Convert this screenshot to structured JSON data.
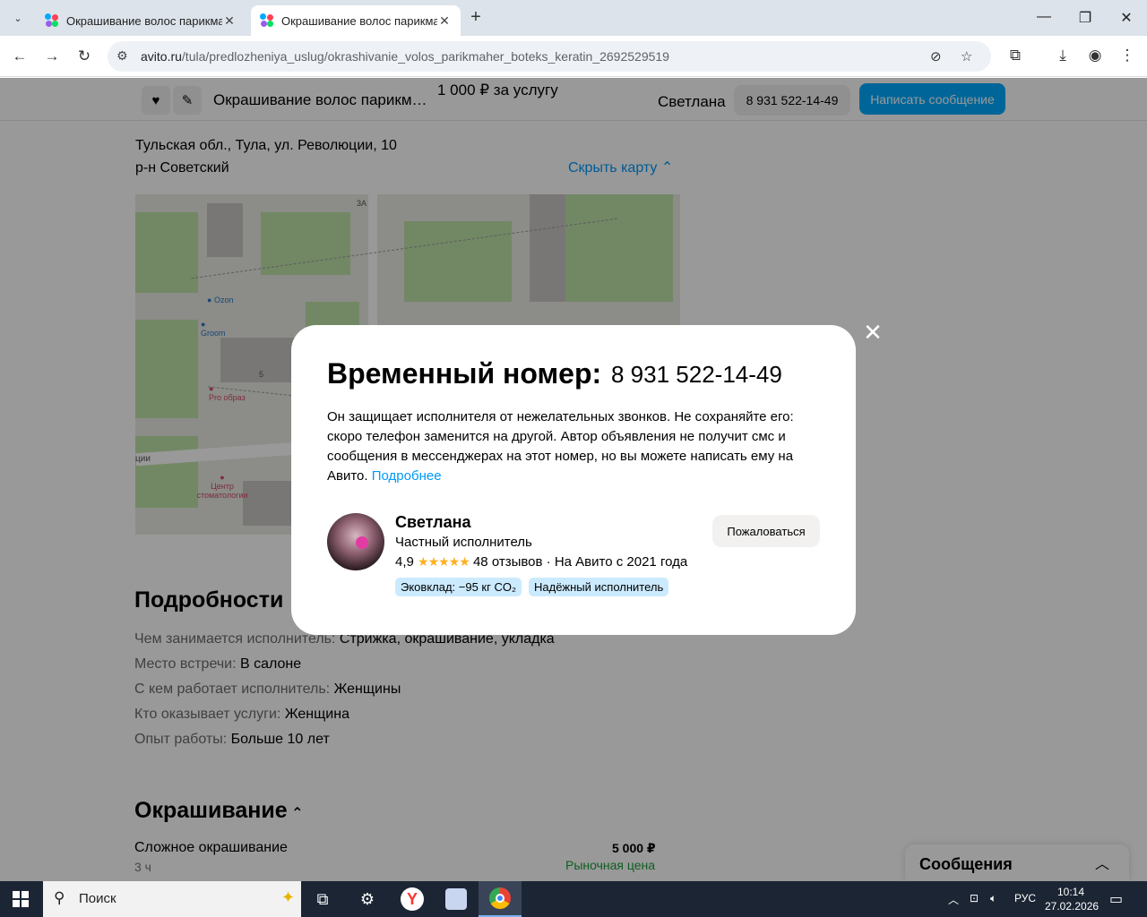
{
  "browser": {
    "tabs": [
      {
        "title": "Окрашивание волос парикмахер",
        "active": false
      },
      {
        "title": "Окрашивание волос парикмахер",
        "active": true
      }
    ],
    "url_domain": "avito.ru",
    "url_path": "/tula/predlozheniya_uslug/okrashivanie_volos_parikmaher_boteks_keratin_2692529519"
  },
  "sticky": {
    "ad_title": "Окрашивание волос парикмахер",
    "price": "1 000 ₽ за услугу",
    "seller": "Светлана",
    "phone": "8 931 522-14-49",
    "message_button": "Написать сообщение"
  },
  "location": {
    "address": "Тульская обл., Тула, ул. Революции, 10",
    "district": "р-н Советский",
    "hide_map": "Скрыть карту"
  },
  "map": {
    "labels": [
      "3А",
      "5"
    ],
    "pois": [
      "Ozon",
      "Groom",
      "Pro образ",
      "Центр стоматологии"
    ],
    "street_fragment": "ции"
  },
  "details": {
    "heading": "Подробности",
    "rows": [
      {
        "key": "Чем занимается исполнитель:",
        "value": "Стрижка, окрашивание, укладка"
      },
      {
        "key": "Место встречи:",
        "value": "В салоне"
      },
      {
        "key": "С кем работает исполнитель:",
        "value": "Женщины"
      },
      {
        "key": "Кто оказывает услуги:",
        "value": "Женщина"
      },
      {
        "key": "Опыт работы:",
        "value": "Больше 10 лет"
      }
    ]
  },
  "services": {
    "heading": "Окрашивание",
    "items": [
      {
        "name": "Сложное окрашивание",
        "duration": "3 ч",
        "price": "5 000 ₽",
        "note": "Рыночная цена"
      }
    ]
  },
  "messages_panel": {
    "title": "Сообщения"
  },
  "modal": {
    "title": "Временный номер:",
    "number": "8 931 522-14-49",
    "text": "Он защищает исполнителя от нежелательных звонков. Не сохраняйте его: скоро телефон заменится на другой. Автор объявления не получит смс и сообщения в мессенджерах на этот номер, но вы можете написать ему на Авито.",
    "more_link": "Подробнее",
    "seller_name": "Светлана",
    "seller_type": "Частный исполнитель",
    "rating": "4,9",
    "stars": "★★★★★",
    "reviews": "48 отзывов",
    "since": "На Авито с 2021 года",
    "badges": [
      "Эковклад: −95 кг CO₂",
      "Надёжный исполнитель"
    ],
    "report_button": "Пожаловаться"
  },
  "taskbar": {
    "search_placeholder": "Поиск",
    "language": "РУС",
    "time": "10:14",
    "date": "27.02.2026"
  },
  "colors": {
    "accent_blue": "#00aaff",
    "link_blue": "#0099f7",
    "badge_bg": "#cbeafe",
    "market_green": "#1c9b3a",
    "star": "#ffb021"
  }
}
